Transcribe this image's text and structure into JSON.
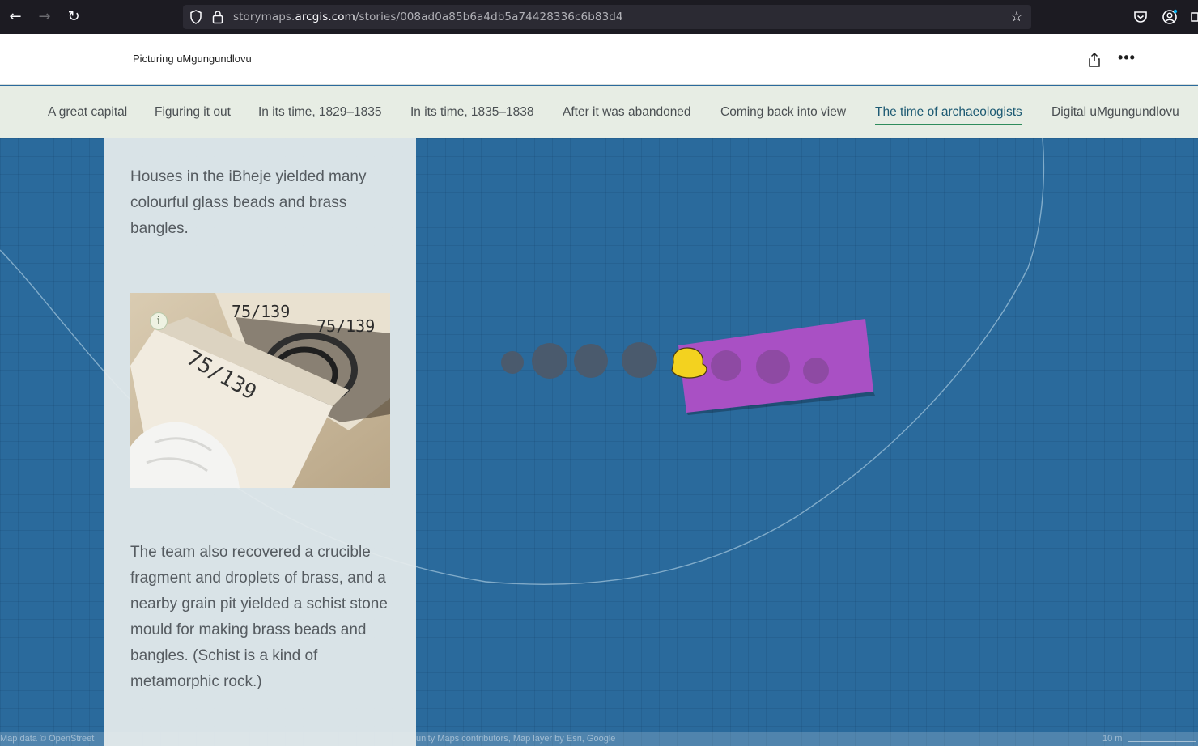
{
  "browser": {
    "url_prefix": "storymaps.",
    "url_host": "arcgis.com",
    "url_path": "/stories/008ad0a85b6a4db5a74428336c6b83d4"
  },
  "header": {
    "title": "Picturing uMgungundlovu"
  },
  "section_nav": {
    "items": [
      {
        "label": "A great capital",
        "active": false
      },
      {
        "label": "Figuring it out",
        "active": false
      },
      {
        "label": "In its time, 1829–1835",
        "active": false
      },
      {
        "label": "In its time, 1835–1838",
        "active": false
      },
      {
        "label": "After it was abandoned",
        "active": false
      },
      {
        "label": "Coming back into view",
        "active": false
      },
      {
        "label": "The time of archaeologists",
        "active": true
      },
      {
        "label": "Digital uMgungundlovu",
        "active": false
      }
    ]
  },
  "panel": {
    "paragraph_1": "Houses in the iBheje yielded many colourful glass beads and brass bangles.",
    "photo_info_glyph": "i",
    "paragraph_2": "The team also recovered a crucible fragment and droplets of brass, and a nearby grain pit yielded a schist stone mould for making brass beads and bangles. (Schist is a kind of metamorphic rock.)"
  },
  "map": {
    "attribution_left": "Map data © OpenStreet",
    "attribution_mid": "unity Maps contributors, Map layer by Esri, Google",
    "scale_label": "10 m",
    "colors": {
      "water": "#2a6a9c",
      "house_circles": "#4a5a6d",
      "highlight_rect": "#a950c4",
      "highlight_marker": "#f3d21f"
    }
  },
  "photo_labels": [
    "75/139",
    "75/139",
    "75/139"
  ]
}
